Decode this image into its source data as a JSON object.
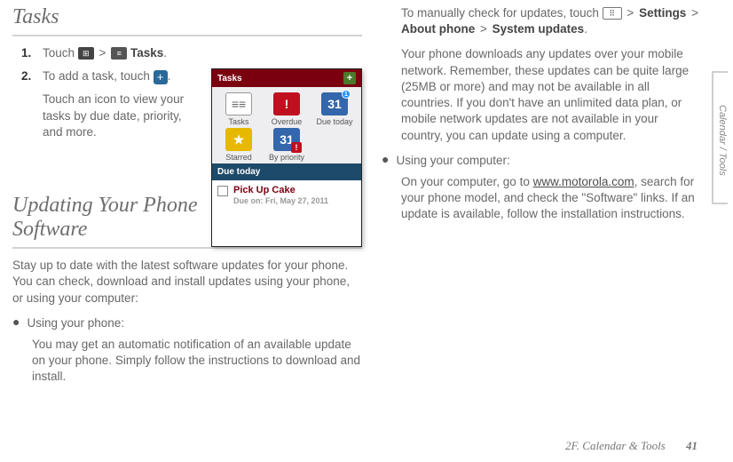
{
  "left": {
    "title1": "Tasks",
    "step1_num": "1.",
    "step1_a": "Touch ",
    "step1_gt": ">",
    "step1_label": "Tasks",
    "step1_dot": ".",
    "step2_num": "2.",
    "step2_a": "To add a task, touch ",
    "step2_dot": ".",
    "step2_b": "Touch an icon to view your tasks by due date, priority, and more.",
    "title2": "Updating Your Phone Software",
    "para1": "Stay up to date with the latest software updates for your phone. You can check, download and install updates using your phone, or using your computer:",
    "bullet1": "Using your phone:",
    "bullet1_body": "You may get an automatic notification of an available update on your phone. Simply follow the instructions to download and install."
  },
  "app": {
    "header": "Tasks",
    "cells": [
      "Tasks",
      "Overdue",
      "Due today",
      "Starred",
      "By priority"
    ],
    "cal_num": "31",
    "due_header": "Due today",
    "item_title": "Pick Up Cake",
    "item_due": "Due on: Fri, May 27, 2011"
  },
  "right": {
    "r1_a": "To manually check for updates, touch ",
    "r1_gt": ">",
    "r1_settings": "Settings",
    "r1_about": "About phone",
    "r1_sys": "System updates",
    "r1_dot": ".",
    "r2": "Your phone downloads any updates over your mobile network. Remember, these updates can be quite large (25MB or more) and may not be available in all countries. If you don't have an unlimited data plan, or mobile network updates are not available in your country, you can update using a computer.",
    "bullet2": "Using your computer:",
    "r3_a": "On your computer, go to ",
    "r3_link": "www.motorola.com",
    "r3_b": ", search for your phone model, and check the \"Software\" links. If an update is available,  follow the installation instructions."
  },
  "sidetab": "Calendar / Tools",
  "footer_section": "2F. Calendar & Tools",
  "footer_page": "41"
}
